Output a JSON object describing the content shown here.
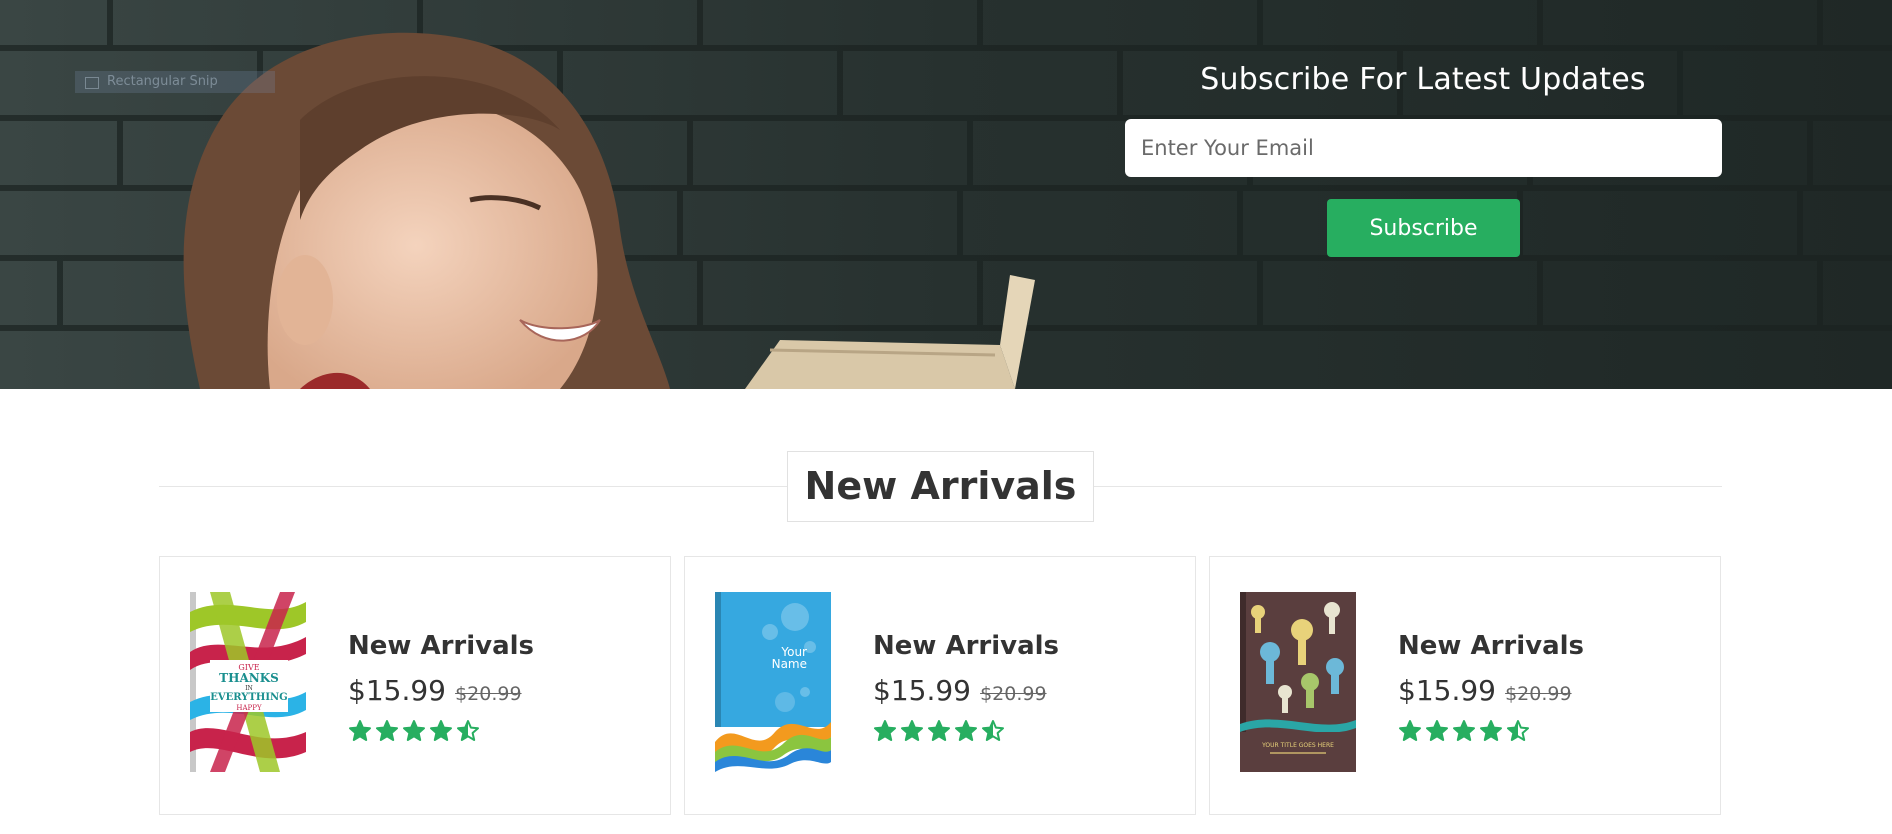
{
  "hero": {
    "snip_label": "Rectangular Snip",
    "title": "Subscribe For Latest Updates",
    "email_placeholder": "Enter Your Email",
    "subscribe_label": "Subscribe"
  },
  "section": {
    "title": "New Arrivals"
  },
  "products": [
    {
      "name": "New Arrivals",
      "price": "$15.99",
      "old_price": "$20.99",
      "rating": 4.5,
      "cover_text": [
        "GIVE",
        "THANKS",
        "IN",
        "EVERYTHING",
        "HAPPY"
      ]
    },
    {
      "name": "New Arrivals",
      "price": "$15.99",
      "old_price": "$20.99",
      "rating": 4.5,
      "cover_text": [
        "Your",
        "Name"
      ]
    },
    {
      "name": "New Arrivals",
      "price": "$15.99",
      "old_price": "$20.99",
      "rating": 4.5,
      "cover_text": [
        "YOUR TITLE GOES HERE"
      ]
    }
  ],
  "colors": {
    "accent": "#27ae60",
    "star": "#27ae60"
  }
}
